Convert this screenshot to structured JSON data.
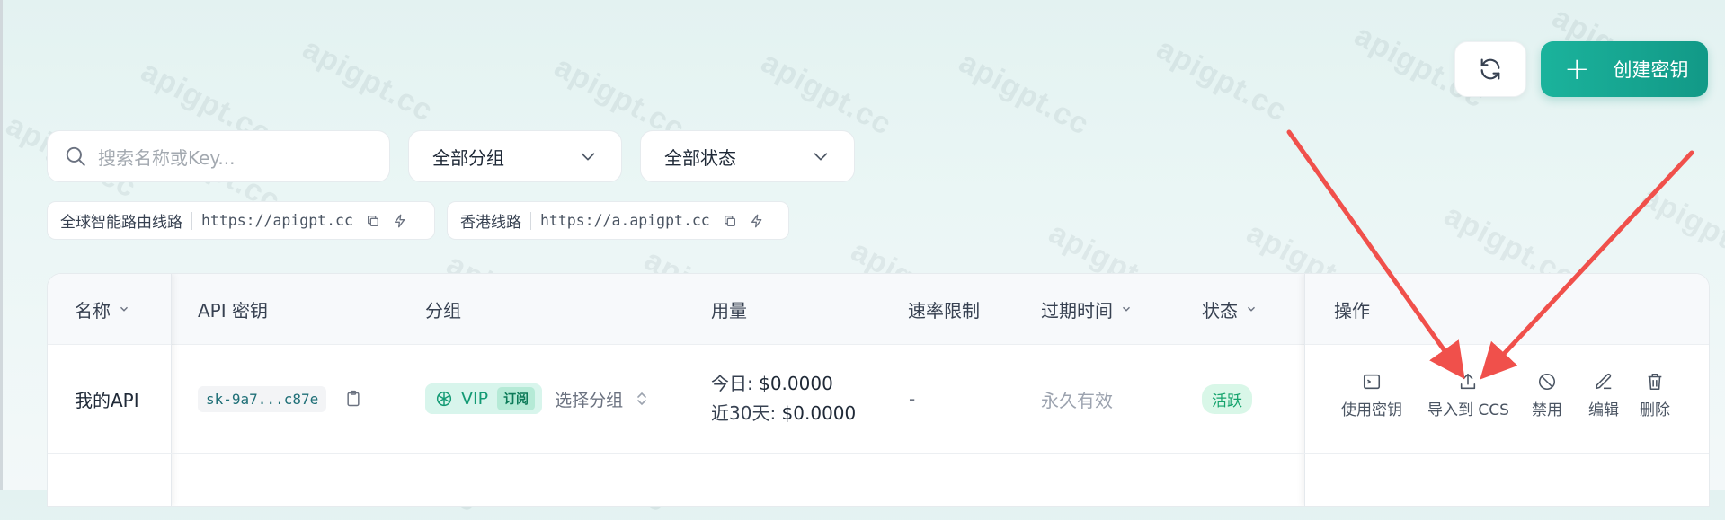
{
  "toolbar": {
    "create_label": "创建密钥",
    "create_plus": "+"
  },
  "filters": {
    "search_placeholder": "搜索名称或Key...",
    "group_select": "全部分组",
    "status_select": "全部状态"
  },
  "routes": [
    {
      "name": "全球智能路由线路",
      "url": "https://apigpt.cc"
    },
    {
      "name": "香港线路",
      "url": "https://a.apigpt.cc"
    }
  ],
  "table": {
    "headers": {
      "name": "名称",
      "api_key": "API 密钥",
      "group": "分组",
      "usage": "用量",
      "rate_limit": "速率限制",
      "expire": "过期时间",
      "status": "状态",
      "actions": "操作"
    },
    "rows": [
      {
        "name": "我的API",
        "api_key": "sk-9a7...c87e",
        "group_name": "VIP",
        "group_badge": "订阅",
        "group_select": "选择分组",
        "usage_today_label": "今日:",
        "usage_today_value": "$0.0000",
        "usage_30d_label": "近30天:",
        "usage_30d_value": "$0.0000",
        "rate_limit": "-",
        "expire": "永久有效",
        "status": "活跃"
      }
    ],
    "actions": {
      "use_key": "使用密钥",
      "import_ccs": "导入到 CCS",
      "disable": "禁用",
      "edit": "编辑",
      "delete": "删除"
    }
  },
  "watermark_text": "apigpt.cc",
  "colors": {
    "accent": "#1bb39c",
    "annotation_arrow": "#f0504b"
  }
}
